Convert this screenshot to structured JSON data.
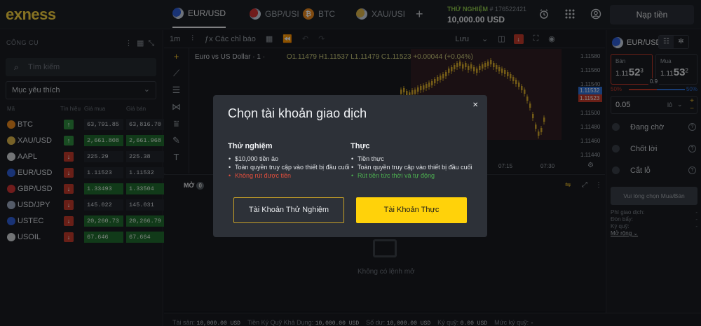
{
  "brand": "exness",
  "tabs": [
    {
      "label": "EUR/USD",
      "active": true
    },
    {
      "label": "GBP/USI",
      "active": false
    },
    {
      "label": "BTC",
      "active": false
    },
    {
      "label": "XAU/USI",
      "active": false
    }
  ],
  "account": {
    "type": "THỬ NGHIỆM",
    "number": "# 176522421",
    "balance": "10,000.00 USD"
  },
  "deposit_label": "Nạp tiền",
  "left": {
    "title": "CÔNG CỤ",
    "search_placeholder": "Tìm kiếm",
    "list_filter": "Mục yêu thích",
    "columns": {
      "symbol": "Mã",
      "signal": "Tín hiệu",
      "bid": "Giá mua",
      "ask": "Giá bán"
    },
    "instruments": [
      {
        "symbol": "BTC",
        "signal": "up",
        "bid": "63,791.85",
        "ask": "63,816.70",
        "bid_hl": false,
        "ask_hl": false,
        "color": "#e8871e"
      },
      {
        "symbol": "XAU/USD",
        "signal": "up",
        "bid": "2,661.808",
        "ask": "2,661.968",
        "bid_hl": true,
        "ask_hl": true,
        "color": "#d9b34a"
      },
      {
        "symbol": "AAPL",
        "signal": "down",
        "bid": "225.29",
        "ask": "225.38",
        "bid_hl": false,
        "ask_hl": false,
        "color": "#cfd3d8"
      },
      {
        "symbol": "EUR/USD",
        "signal": "down",
        "bid": "1.11523",
        "ask": "1.11532",
        "bid_hl": false,
        "ask_hl": false,
        "color": "#2f5ed6"
      },
      {
        "symbol": "GBP/USD",
        "signal": "down",
        "bid": "1.33493",
        "ask": "1.33504",
        "bid_hl": true,
        "ask_hl": true,
        "color": "#c33"
      },
      {
        "symbol": "USD/JPY",
        "signal": "down",
        "bid": "145.022",
        "ask": "145.031",
        "bid_hl": false,
        "ask_hl": false,
        "color": "#9aa6bd"
      },
      {
        "symbol": "USTEC",
        "signal": "down",
        "bid": "20,260.73",
        "ask": "20,266.79",
        "bid_hl": true,
        "ask_hl": true,
        "color": "#2f5ed6"
      },
      {
        "symbol": "USOIL",
        "signal": "down",
        "bid": "67.646",
        "ask": "67.664",
        "bid_hl": true,
        "ask_hl": true,
        "color": "#cfd3d8"
      }
    ]
  },
  "chart": {
    "timeframe": "1m",
    "indicators_label": "Các chỉ báo",
    "save_label": "Lưu",
    "legend": {
      "title": "Euro vs US Dollar · 1 ·",
      "ohlc": "O1.11479 H1.11537 L1.11479 C1.11523 +0.00044 (+0.04%)"
    },
    "y_ticks": [
      "1.11580",
      "1.11560",
      "1.11540",
      "1.11500",
      "1.11480",
      "1.11460",
      "1.11440"
    ],
    "ask_tag": "1.11532",
    "bid_tag": "1.11523",
    "x_ticks": [
      "07:15",
      "07:30"
    ]
  },
  "bottom": {
    "tab_label": "MỞ",
    "tab_count": "0",
    "empty_text": "Không có lệnh mở"
  },
  "status": {
    "equity_label": "Tài sản:",
    "equity": "10,000.00 USD",
    "free_margin_label": "Tiền Ký Quỹ Khả Dụng:",
    "free_margin": "10,000.00 USD",
    "balance_label": "Số dư:",
    "balance": "10,000.00 USD",
    "margin_label": "Ký quỹ:",
    "margin": "0.00 USD",
    "margin_level_label": "Mức ký quỹ:",
    "margin_level": "-"
  },
  "right": {
    "symbol": "EUR/USD",
    "sell": {
      "label": "Bán",
      "prefix": "1.11",
      "big": "52",
      "sup": "3"
    },
    "buy": {
      "label": "Mua",
      "prefix": "1.11",
      "big": "53",
      "sup": "2"
    },
    "spread": "0.9",
    "sell_pct": "50%",
    "buy_pct": "50%",
    "volume": "0.05",
    "volume_unit": "lô",
    "options": [
      "Đang chờ",
      "Chốt lời",
      "Cắt lỗ"
    ],
    "choose_label": "Vui lòng chọn Mua/Bán",
    "fees": [
      "Phí giao dịch:",
      "Đòn bẩy:",
      "Ký quỹ:",
      "Mở rộng"
    ]
  },
  "modal": {
    "title": "Chọn tài khoản giao dịch",
    "demo": {
      "heading": "Thử nghiệm",
      "items": [
        "$10,000 tiền ảo",
        "Toàn quyền truy cập vào thiết bị đầu cuối",
        "Không rút được tiền"
      ],
      "button": "Tài Khoản Thử Nghiệm"
    },
    "real": {
      "heading": "Thực",
      "items": [
        "Tiền thực",
        "Toàn quyền truy cập vào thiết bị đầu cuối",
        "Rút tiền tức thời và tự động"
      ],
      "button": "Tài Khoản Thực"
    }
  },
  "colors": {
    "brand": "#f4d03f",
    "up": "#2e8b3e",
    "down": "#c0392b",
    "primary_button": "#ffd20a"
  }
}
